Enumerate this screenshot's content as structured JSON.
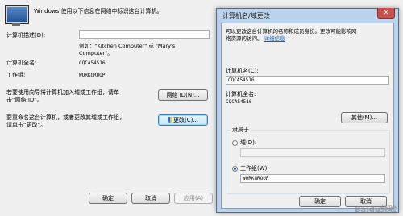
{
  "system_properties": {
    "intro": "Windows 使用以下信息在网络中标识这台计算机。",
    "description_label": "计算机描述(D):",
    "description_value": "",
    "example_text_1": "例如：\"Kitchen Computer\" 或 \"Mary's",
    "example_text_2": "Computer\"。",
    "full_name_label": "计算机全名:",
    "full_name_value": "CQCA54516",
    "workgroup_label": "工作组:",
    "workgroup_value": "WORKGROUP",
    "wizard_text_1": "若要使用向导将计算机加入域或工作组，请单",
    "wizard_text_2": "击“网络 ID”。",
    "network_id_button": "网络 ID(N)...",
    "rename_text_1": "要重命名这台计算机，或者更改其域或工作组，",
    "rename_text_2": "请单击“更改”。",
    "change_button": "更改(C)...",
    "ok_button": "确定",
    "cancel_button": "取消",
    "apply_button": "应用(A)"
  },
  "dialog": {
    "title": "计算机名/域更改",
    "close_glyph": "✕",
    "info_text_1": "可以更改这台计算机的名称和成员身份。更改可能影响网",
    "info_text_2": "络资源的访问。",
    "info_link": "详细信息",
    "computer_name_label": "计算机名(C):",
    "computer_name_value": "CQCA54516",
    "full_name_label": "计算机全名:",
    "full_name_value": "CQCA54516",
    "more_button": "其他(M)...",
    "member_of_label": "隶属于",
    "domain_label": "域(D):",
    "domain_value": "",
    "workgroup_label": "工作组(W):",
    "workgroup_value": "WORKGROUP",
    "ok_button": "确定",
    "cancel_button": "取消"
  },
  "watermark": "Baidu经验",
  "colors": {
    "title_bar": "#bcd3ec",
    "link": "#0066cc",
    "focus_border": "#3c7fb1"
  }
}
